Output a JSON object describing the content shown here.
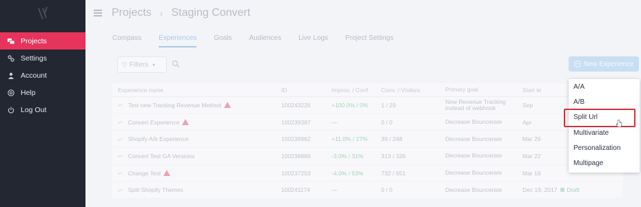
{
  "sidebar": {
    "items": [
      {
        "label": "Projects",
        "icon": "projects-icon",
        "active": true
      },
      {
        "label": "Settings",
        "icon": "settings-icon",
        "active": false
      },
      {
        "label": "Account",
        "icon": "account-icon",
        "active": false
      },
      {
        "label": "Help",
        "icon": "help-icon",
        "active": false
      },
      {
        "label": "Log Out",
        "icon": "power-icon",
        "active": false
      }
    ]
  },
  "header": {
    "breadcrumb_root": "Projects",
    "separator": "›",
    "breadcrumb_current": "Staging Convert"
  },
  "tabs": [
    {
      "label": "Compass"
    },
    {
      "label": "Experiences",
      "active": true
    },
    {
      "label": "Goals"
    },
    {
      "label": "Audiences"
    },
    {
      "label": "Live Logs"
    },
    {
      "label": "Project Settings"
    }
  ],
  "toolbar": {
    "filters_label": "Filters",
    "new_experience_label": "New Experience"
  },
  "table": {
    "columns": [
      "Experience name",
      "ID",
      "Improv. / Conf",
      "Conv. / Visitors",
      "Primary goal",
      "Start te"
    ],
    "rows": [
      {
        "name": "Test new Tracking Revenue Method",
        "warn": true,
        "id": "100243226",
        "improv": "+100.0% / 0%",
        "conv": "1 / 29",
        "goal": "New Revenue Tracking instead of webhook",
        "start": "Sep"
      },
      {
        "name": "Convert Experience",
        "warn": true,
        "id": "100239387",
        "improv": "—",
        "conv": "0 / 0",
        "goal": "Decrease Bouncerate",
        "start": "Apr"
      },
      {
        "name": "Shopify A/b Experience",
        "warn": false,
        "id": "100238962",
        "improv": "+11.0% / 27%",
        "conv": "39 / 248",
        "goal": "Decrease Bouncerate",
        "start": "Mar 29"
      },
      {
        "name": "Convert Test GA Versions",
        "warn": false,
        "id": "100238869",
        "improv": "-3.0% / 31%",
        "conv": "313 / 326",
        "goal": "Decrease Bouncerate",
        "start": "Mar 22"
      },
      {
        "name": "Change Text",
        "warn": true,
        "id": "100237253",
        "improv": "-4.0% / 53%",
        "conv": "732 / 851",
        "goal": "Decrease Bouncerate",
        "start": "Mar 18"
      },
      {
        "name": "Split Shopify Themes",
        "warn": false,
        "id": "100241174",
        "improv": "—",
        "conv": "0 / 0",
        "goal": "Decrease Bouncerate",
        "start": "Dec 19, 2017",
        "status": "Draft"
      }
    ]
  },
  "dropdown": {
    "items": [
      "A/A",
      "A/B",
      "Split Url",
      "Multivariate",
      "Personalization",
      "Multipage"
    ],
    "highlighted": "Split Url"
  },
  "colors": {
    "sidebar_bg": "#232732",
    "active_nav": "#e7345c",
    "accent_blue": "#3d8fd6",
    "highlight_red": "#c6353d"
  }
}
